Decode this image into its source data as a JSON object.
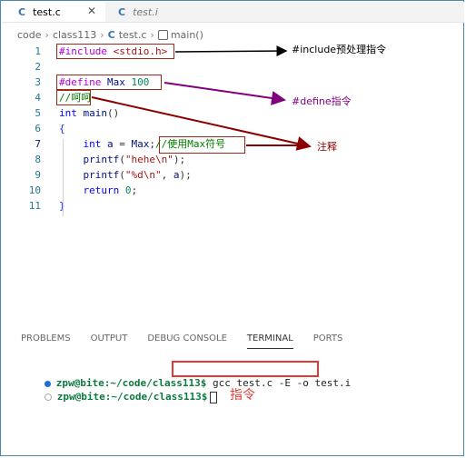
{
  "tabs": [
    {
      "icon": "C",
      "label": "test.c",
      "close": "✕"
    },
    {
      "icon": "C",
      "label": "test.i"
    }
  ],
  "breadcrumb": {
    "items": [
      "code",
      "class113",
      "test.c",
      "main()"
    ],
    "c_icon": "C"
  },
  "code_lines": [
    {
      "n": "1",
      "html": "<span class=\"kw-pre\">#include</span> <span class=\"str\">&lt;stdio.h&gt;</span>"
    },
    {
      "n": "2",
      "html": ""
    },
    {
      "n": "3",
      "html": "<span class=\"kw-pre\">#define</span> <span class=\"ident\">Max</span> <span class=\"num\">100</span>"
    },
    {
      "n": "4",
      "html": "<span class=\"cmt\">//呵呵</span>"
    },
    {
      "n": "5",
      "html": "<span class=\"kw\">int</span> <span class=\"ident\">main</span>()"
    },
    {
      "n": "6",
      "html": "<span class=\"brace\">{</span>"
    },
    {
      "n": "7",
      "html": "    <span class=\"kw\">int</span> <span class=\"ident\">a</span> = <span class=\"ident\">Max</span>;<span class=\"cmt\">//使用Max符号</span>"
    },
    {
      "n": "8",
      "html": "    <span class=\"ident\">printf</span>(<span class=\"str\">\"hehe\\n\"</span>);"
    },
    {
      "n": "9",
      "html": "    <span class=\"ident\">printf</span>(<span class=\"str\">\"%d\\n\"</span>, <span class=\"ident\">a</span>);"
    },
    {
      "n": "10",
      "html": "    <span class=\"kw\">return</span> <span class=\"num\">0</span>;"
    },
    {
      "n": "11",
      "html": "<span class=\"brace\">}</span>"
    }
  ],
  "annotations": {
    "include": "#include预处理指令",
    "define": "#define指令",
    "comment": "注释",
    "command": "指令"
  },
  "panel_tabs": [
    "PROBLEMS",
    "OUTPUT",
    "DEBUG CONSOLE",
    "TERMINAL",
    "PORTS"
  ],
  "terminal": {
    "prompt": "zpw@bite:~/code/class113$",
    "command": "gcc test.c -E -o test.i"
  },
  "colors": {
    "frame_border": "#4a86b8",
    "annotation_red": "#9c2a1c",
    "include_arrow": "#000000",
    "define_arrow": "#800080",
    "comment_arrow": "#8b0000",
    "command_text": "#e53935"
  }
}
